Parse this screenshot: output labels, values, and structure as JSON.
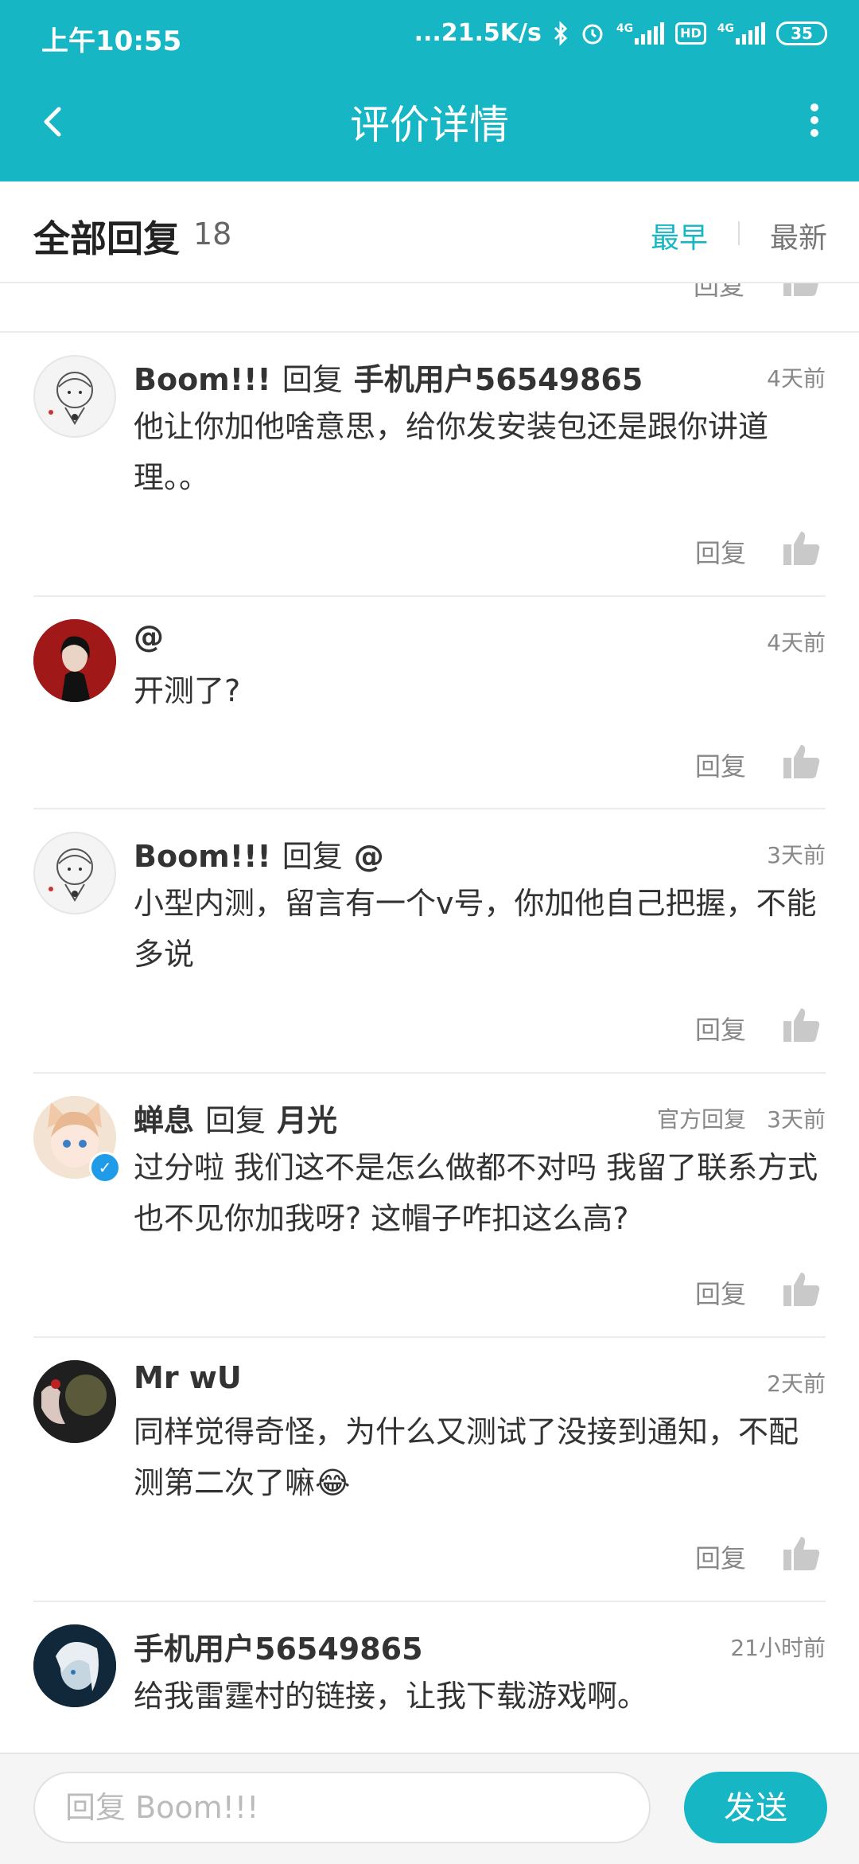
{
  "status_bar": {
    "time": "上午10:55",
    "network_speed": "...21.5K/s",
    "signal_label_1": "4G",
    "hd_label": "HD",
    "signal_label_2": "4G",
    "battery": "35"
  },
  "nav": {
    "title": "评价详情"
  },
  "sort_bar": {
    "title": "全部回复",
    "count": "18",
    "earliest": "最早",
    "latest": "最新"
  },
  "partial_item": {
    "reply_label": "回复"
  },
  "comments": [
    {
      "author": "Boom!!!",
      "reply_word": "回复",
      "target": "手机用户56549865",
      "time": "4天前",
      "content": "他让你加他啥意思，给你发安装包还是跟你讲道理。。",
      "reply_label": "回复"
    },
    {
      "author": "@",
      "time": "4天前",
      "content": "开测了?",
      "reply_label": "回复"
    },
    {
      "author": "Boom!!!",
      "reply_word": "回复",
      "target": "@",
      "time": "3天前",
      "content": "小型内测，留言有一个v号，你加他自己把握，不能多说",
      "reply_label": "回复"
    },
    {
      "author": "蝉息",
      "reply_word": "回复",
      "target": "月光",
      "official_label": "官方回复",
      "time": "3天前",
      "content": "过分啦 我们这不是怎么做都不对吗  我留了联系方式也不见你加我呀? 这帽子咋扣这么高?",
      "reply_label": "回复"
    },
    {
      "author": "Mr wU",
      "time": "2天前",
      "content": "同样觉得奇怪，为什么又测试了没接到通知，不配测第二次了嘛😂",
      "reply_label": "回复"
    },
    {
      "author": "手机用户56549865",
      "time": "21小时前",
      "content": "给我雷霆村的链接，让我下载游戏啊。"
    }
  ],
  "bottom_bar": {
    "input_placeholder": "回复 Boom!!!",
    "send_label": "发送"
  },
  "colors": {
    "accent": "#17b6c5"
  }
}
